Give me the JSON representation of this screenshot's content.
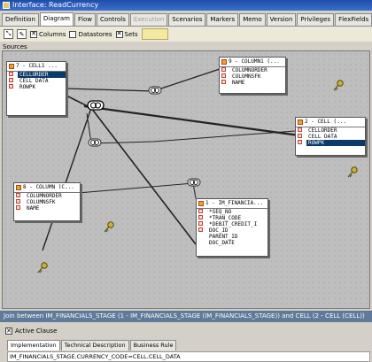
{
  "window": {
    "title": "Interface: ReadCurrency"
  },
  "tabs": [
    {
      "label": "Definition",
      "state": "normal"
    },
    {
      "label": "Diagram",
      "state": "active"
    },
    {
      "label": "Flow",
      "state": "normal"
    },
    {
      "label": "Controls",
      "state": "normal"
    },
    {
      "label": "Execution",
      "state": "disabled"
    },
    {
      "label": "Scenarios",
      "state": "normal"
    },
    {
      "label": "Markers",
      "state": "normal"
    },
    {
      "label": "Memo",
      "state": "normal"
    },
    {
      "label": "Version",
      "state": "normal"
    },
    {
      "label": "Privileges",
      "state": "normal"
    },
    {
      "label": "FlexFields",
      "state": "normal"
    }
  ],
  "toolbar": {
    "columns_label": "Columns",
    "columns_checked": true,
    "datastores_label": "Datastores",
    "datastores_checked": false,
    "sets_label": "Sets",
    "sets_checked": true
  },
  "sources_label": "Sources",
  "nodes": {
    "cell1": {
      "title": "7 - CELL1 ...",
      "columns": [
        "CELLORDER",
        "CELL DATA",
        "ROWPK"
      ],
      "selected": 0
    },
    "column1": {
      "title": "9 - COLUMN1 (...",
      "columns": [
        "COLUMNORDER",
        "COLUMNSFK",
        "NAME"
      ],
      "selected": -1
    },
    "cell": {
      "title": "2 - CELL (...",
      "columns": [
        "CELLORDER",
        "CELL DATA",
        "ROWPK"
      ],
      "selected": 2
    },
    "column": {
      "title": "8 - COLUMN (C...",
      "columns": [
        "COLUMNORDER",
        "COLUMNSFK",
        "NAME"
      ],
      "selected": -1
    },
    "im_fin": {
      "title": "1 - IM_FINANCIA...",
      "columns": [
        "*SEQ_NO",
        "*TRAN_CODE",
        "*DEBIT_CREDIT_I",
        "DOC_ID",
        "PARENT_ID",
        "DOC_DATE"
      ],
      "selected": -1
    }
  },
  "join": {
    "title": "Join between IM_FINANCIALS_STAGE (1 - IM_FINANCIALS_STAGE (IM_FINANCIALS_STAGE)) and CELL (2 - CELL (CELL))",
    "active_clause_label": "Active Clause",
    "active_clause_checked": true,
    "tabs": [
      "Implementation",
      "Technical Description",
      "Business Rule"
    ],
    "expression": "IM_FINANCIALS_STAGE.CURRENCY_CODE=CELL.CELL_DATA"
  },
  "colors": {
    "selection": "#0a3a6a",
    "canvas": "#bebebe",
    "title_bar": "#1f4ea8",
    "join_bar": "#607a9a"
  }
}
